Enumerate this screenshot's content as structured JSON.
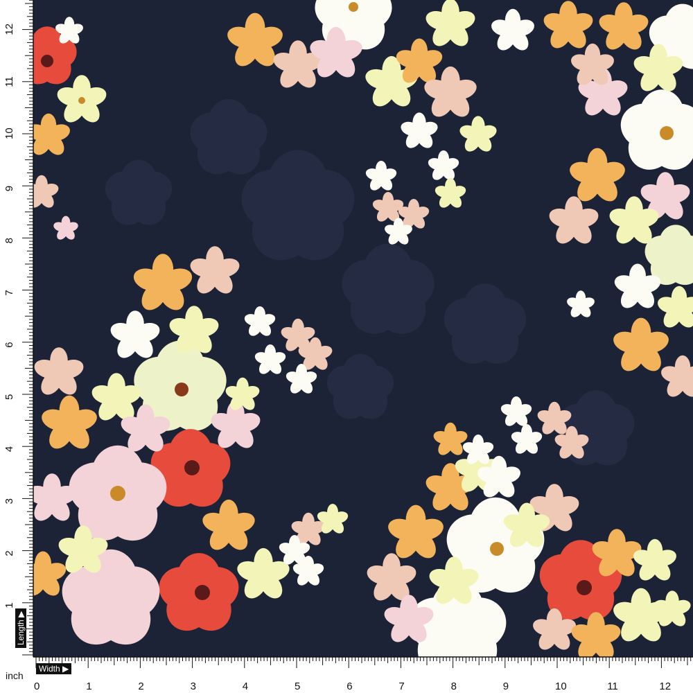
{
  "image": {
    "subject": "floral print fabric swatch with measuring rulers",
    "background_color": "#1d2336",
    "flower_colors": [
      "#e64b3c",
      "#f4d3d8",
      "#f2f5b7",
      "#f3b35a",
      "#f0c8b6",
      "#fdfcf4",
      "#a9b49a"
    ]
  },
  "ruler": {
    "unit_label": "inch",
    "width_label": "Width",
    "length_label": "Length",
    "width_ticks": [
      "0",
      "1",
      "2",
      "3",
      "4",
      "5",
      "6",
      "7",
      "8",
      "9",
      "10",
      "11",
      "12"
    ],
    "length_ticks": [
      "0",
      "1",
      "2",
      "3",
      "4",
      "5",
      "6",
      "7",
      "8",
      "9",
      "10",
      "11",
      "12"
    ],
    "badge_arrow_icon": "triangle-right-icon"
  }
}
